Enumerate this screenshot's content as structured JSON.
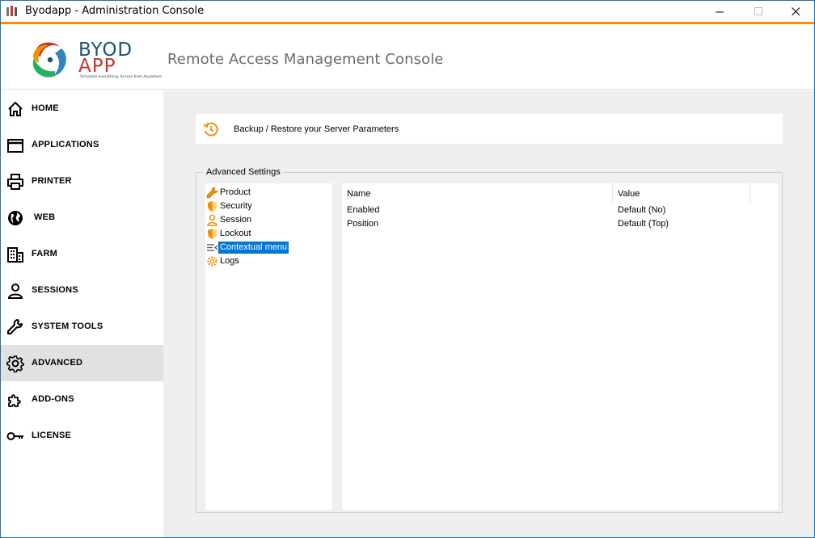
{
  "window": {
    "title": "Byodapp - Administration Console"
  },
  "header": {
    "logo_top": "BYOD",
    "logo_bottom": "APP",
    "logo_tagline": "Virtualize everything, Access from Anywhere",
    "title": "Remote Access Management Console"
  },
  "sidebar": {
    "items": [
      {
        "label": "HOME",
        "icon": "home-icon"
      },
      {
        "label": "APPLICATIONS",
        "icon": "window-icon"
      },
      {
        "label": "PRINTER",
        "icon": "printer-icon"
      },
      {
        "label": "WEB",
        "icon": "globe-icon"
      },
      {
        "label": "FARM",
        "icon": "building-icon"
      },
      {
        "label": "SESSIONS",
        "icon": "user-icon"
      },
      {
        "label": "SYSTEM TOOLS",
        "icon": "wrench-icon"
      },
      {
        "label": "ADVANCED",
        "icon": "gear-icon"
      },
      {
        "label": "ADD-ONS",
        "icon": "puzzle-icon"
      },
      {
        "label": "LICENSE",
        "icon": "key-icon"
      }
    ],
    "active": "ADVANCED"
  },
  "backup": {
    "label": "Backup / Restore your Server Parameters"
  },
  "advanced": {
    "group_title": "Advanced Settings",
    "tree": [
      {
        "label": "Product",
        "icon": "wrench-icon"
      },
      {
        "label": "Security",
        "icon": "shield-icon"
      },
      {
        "label": "Session",
        "icon": "user-icon"
      },
      {
        "label": "Lockout",
        "icon": "shield-icon"
      },
      {
        "label": "Contextual menu",
        "icon": "menu-icon"
      },
      {
        "label": "Logs",
        "icon": "gear-icon"
      }
    ],
    "selected": "Contextual menu",
    "grid": {
      "columns": [
        "Name",
        "Value"
      ],
      "rows": [
        {
          "name": "Enabled",
          "value": "Default (No)"
        },
        {
          "name": "Position",
          "value": "Default (Top)"
        }
      ]
    }
  },
  "colors": {
    "accent": "#f39200",
    "selection": "#0078d7",
    "window_border": "#1e6fb5"
  }
}
